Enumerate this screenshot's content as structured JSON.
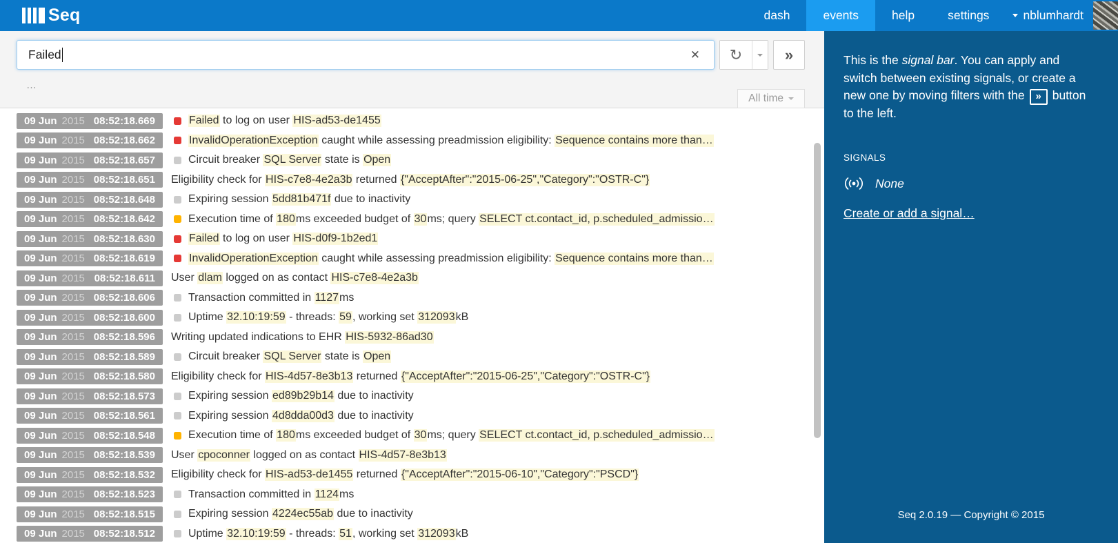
{
  "colors": {
    "topbar": "#0b79c9",
    "active-tab": "#1b9cf0",
    "sidebar": "#0b5a8d",
    "error": "#e53935",
    "warning": "#ffb300",
    "debug": "#cccccc",
    "highlight": "#fbf7d8",
    "badge": "#9e9e9e"
  },
  "topbar": {
    "logo_text": "Seq",
    "nav": [
      {
        "label": "dash",
        "active": false
      },
      {
        "label": "events",
        "active": true
      },
      {
        "label": "help",
        "active": false
      },
      {
        "label": "settings",
        "active": false
      }
    ],
    "account": {
      "label": "nblumhardt"
    }
  },
  "search": {
    "value": "Failed",
    "clear_icon": "✕",
    "refresh_icon": "↻",
    "apply_icon": "»",
    "ellipsis": "…"
  },
  "time_range": {
    "label": "All time"
  },
  "sidebar": {
    "intro": {
      "part1": "This is the ",
      "italic": "signal bar",
      "part2": ". You can apply and switch between existing signals, or create a new one by moving filters with the ",
      "button_glyph": "»",
      "part3": " button to the left."
    },
    "signals_heading": "SIGNALS",
    "signal_none": "None",
    "create_link": "Create or add a signal…",
    "footer": "Seq 2.0.19 — Copyright © 2015"
  },
  "events": {
    "date": "09 Jun",
    "year": "2015",
    "rows": [
      {
        "time": "08:52:18.669",
        "level": "error",
        "segments": [
          {
            "t": "Failed",
            "h": true
          },
          {
            "t": " to log on user ",
            "h": false
          },
          {
            "t": "HIS-ad53-de1455",
            "h": true
          }
        ]
      },
      {
        "time": "08:52:18.662",
        "level": "error",
        "segments": [
          {
            "t": "InvalidOperationException",
            "h": true
          },
          {
            "t": " caught while assessing preadmission eligibility: ",
            "h": false
          },
          {
            "t": "Sequence contains more than…",
            "h": true
          }
        ]
      },
      {
        "time": "08:52:18.657",
        "level": "debug",
        "segments": [
          {
            "t": "Circuit breaker ",
            "h": false
          },
          {
            "t": "SQL Server",
            "h": true
          },
          {
            "t": " state is ",
            "h": false
          },
          {
            "t": "Open",
            "h": true
          }
        ]
      },
      {
        "time": "08:52:18.651",
        "level": "info",
        "segments": [
          {
            "t": "Eligibility check for ",
            "h": false
          },
          {
            "t": "HIS-c7e8-4e2a3b",
            "h": true
          },
          {
            "t": " returned ",
            "h": false
          },
          {
            "t": "{\"AcceptAfter\":\"2015-06-25\",\"Category\":\"OSTR-C\"}",
            "h": true
          }
        ]
      },
      {
        "time": "08:52:18.648",
        "level": "debug",
        "segments": [
          {
            "t": "Expiring session ",
            "h": false
          },
          {
            "t": "5dd81b471f",
            "h": true
          },
          {
            "t": " due to inactivity",
            "h": false
          }
        ]
      },
      {
        "time": "08:52:18.642",
        "level": "warning",
        "segments": [
          {
            "t": "Execution time of ",
            "h": false
          },
          {
            "t": "180",
            "h": true
          },
          {
            "t": "ms exceeded budget of ",
            "h": false
          },
          {
            "t": "30",
            "h": true
          },
          {
            "t": "ms; query ",
            "h": false
          },
          {
            "t": "SELECT ct.contact_id, p.scheduled_admissio…",
            "h": true
          }
        ]
      },
      {
        "time": "08:52:18.630",
        "level": "error",
        "segments": [
          {
            "t": "Failed",
            "h": true
          },
          {
            "t": " to log on user ",
            "h": false
          },
          {
            "t": "HIS-d0f9-1b2ed1",
            "h": true
          }
        ]
      },
      {
        "time": "08:52:18.619",
        "level": "error",
        "segments": [
          {
            "t": "InvalidOperationException",
            "h": true
          },
          {
            "t": " caught while assessing preadmission eligibility: ",
            "h": false
          },
          {
            "t": "Sequence contains more than…",
            "h": true
          }
        ]
      },
      {
        "time": "08:52:18.611",
        "level": "info",
        "segments": [
          {
            "t": "User ",
            "h": false
          },
          {
            "t": "dlam",
            "h": true
          },
          {
            "t": " logged on as contact ",
            "h": false
          },
          {
            "t": "HIS-c7e8-4e2a3b",
            "h": true
          }
        ]
      },
      {
        "time": "08:52:18.606",
        "level": "debug",
        "segments": [
          {
            "t": "Transaction committed in ",
            "h": false
          },
          {
            "t": "1127",
            "h": true
          },
          {
            "t": "ms",
            "h": false
          }
        ]
      },
      {
        "time": "08:52:18.600",
        "level": "debug",
        "segments": [
          {
            "t": "Uptime ",
            "h": false
          },
          {
            "t": "32.10:19:59",
            "h": true
          },
          {
            "t": " - threads: ",
            "h": false
          },
          {
            "t": "59",
            "h": true
          },
          {
            "t": ", working set ",
            "h": false
          },
          {
            "t": "312093",
            "h": true
          },
          {
            "t": "kB",
            "h": false
          }
        ]
      },
      {
        "time": "08:52:18.596",
        "level": "info",
        "segments": [
          {
            "t": "Writing updated indications to EHR ",
            "h": false
          },
          {
            "t": "HIS-5932-86ad30",
            "h": true
          }
        ]
      },
      {
        "time": "08:52:18.589",
        "level": "debug",
        "segments": [
          {
            "t": "Circuit breaker ",
            "h": false
          },
          {
            "t": "SQL Server",
            "h": true
          },
          {
            "t": " state is ",
            "h": false
          },
          {
            "t": "Open",
            "h": true
          }
        ]
      },
      {
        "time": "08:52:18.580",
        "level": "info",
        "segments": [
          {
            "t": "Eligibility check for ",
            "h": false
          },
          {
            "t": "HIS-4d57-8e3b13",
            "h": true
          },
          {
            "t": " returned ",
            "h": false
          },
          {
            "t": "{\"AcceptAfter\":\"2015-06-25\",\"Category\":\"OSTR-C\"}",
            "h": true
          }
        ]
      },
      {
        "time": "08:52:18.573",
        "level": "debug",
        "segments": [
          {
            "t": "Expiring session ",
            "h": false
          },
          {
            "t": "ed89b29b14",
            "h": true
          },
          {
            "t": " due to inactivity",
            "h": false
          }
        ]
      },
      {
        "time": "08:52:18.561",
        "level": "debug",
        "segments": [
          {
            "t": "Expiring session ",
            "h": false
          },
          {
            "t": "4d8dda00d3",
            "h": true
          },
          {
            "t": " due to inactivity",
            "h": false
          }
        ]
      },
      {
        "time": "08:52:18.548",
        "level": "warning",
        "segments": [
          {
            "t": "Execution time of ",
            "h": false
          },
          {
            "t": "180",
            "h": true
          },
          {
            "t": "ms exceeded budget of ",
            "h": false
          },
          {
            "t": "30",
            "h": true
          },
          {
            "t": "ms; query ",
            "h": false
          },
          {
            "t": "SELECT ct.contact_id, p.scheduled_admissio…",
            "h": true
          }
        ]
      },
      {
        "time": "08:52:18.539",
        "level": "info",
        "segments": [
          {
            "t": "User ",
            "h": false
          },
          {
            "t": "cpoconner",
            "h": true
          },
          {
            "t": " logged on as contact ",
            "h": false
          },
          {
            "t": "HIS-4d57-8e3b13",
            "h": true
          }
        ]
      },
      {
        "time": "08:52:18.532",
        "level": "info",
        "segments": [
          {
            "t": "Eligibility check for ",
            "h": false
          },
          {
            "t": "HIS-ad53-de1455",
            "h": true
          },
          {
            "t": " returned ",
            "h": false
          },
          {
            "t": "{\"AcceptAfter\":\"2015-06-10\",\"Category\":\"PSCD\"}",
            "h": true
          }
        ]
      },
      {
        "time": "08:52:18.523",
        "level": "debug",
        "segments": [
          {
            "t": "Transaction committed in ",
            "h": false
          },
          {
            "t": "1124",
            "h": true
          },
          {
            "t": "ms",
            "h": false
          }
        ]
      },
      {
        "time": "08:52:18.515",
        "level": "debug",
        "segments": [
          {
            "t": "Expiring session ",
            "h": false
          },
          {
            "t": "4224ec55ab",
            "h": true
          },
          {
            "t": " due to inactivity",
            "h": false
          }
        ]
      },
      {
        "time": "08:52:18.512",
        "level": "debug",
        "segments": [
          {
            "t": "Uptime ",
            "h": false
          },
          {
            "t": "32.10:19:59",
            "h": true
          },
          {
            "t": " - threads: ",
            "h": false
          },
          {
            "t": "51",
            "h": true
          },
          {
            "t": ", working set ",
            "h": false
          },
          {
            "t": "312093",
            "h": true
          },
          {
            "t": "kB",
            "h": false
          }
        ]
      }
    ]
  }
}
